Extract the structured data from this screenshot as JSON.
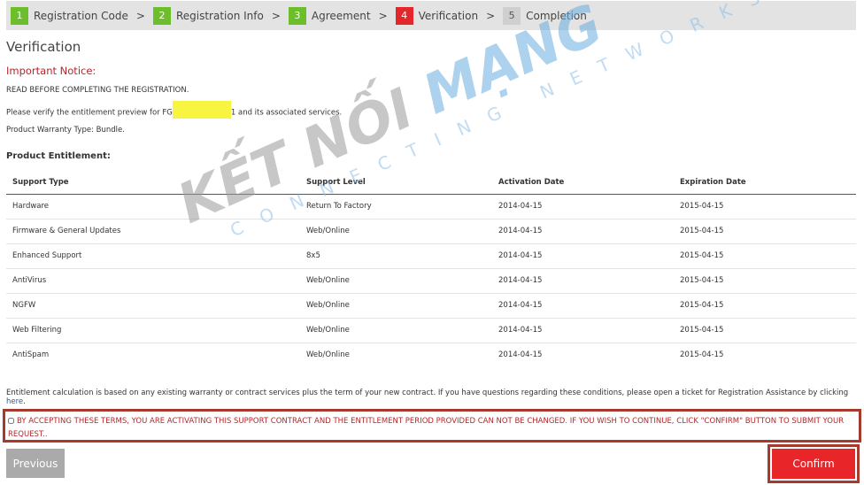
{
  "steps": [
    {
      "num": "1",
      "label": "Registration Code",
      "state": "done"
    },
    {
      "num": "2",
      "label": "Registration Info",
      "state": "done"
    },
    {
      "num": "3",
      "label": "Agreement",
      "state": "done"
    },
    {
      "num": "4",
      "label": "Verification",
      "state": "current"
    },
    {
      "num": "5",
      "label": "Completion",
      "state": "pending"
    }
  ],
  "step_separator": ">",
  "title": "Verification",
  "notice_title": "Important Notice:",
  "notice_line1": "READ BEFORE COMPLETING THE REGISTRATION.",
  "verify_prefix": "Please verify the entitlement preview for FG",
  "verify_suffix": "1 and its associated services.",
  "warranty": "Product Warranty Type:  Bundle.",
  "entitlement_title": "Product Entitlement:",
  "table": {
    "headers": [
      "Support Type",
      "Support Level",
      "Activation Date",
      "Expiration Date"
    ],
    "rows": [
      [
        "Hardware",
        "Return To Factory",
        "2014-04-15",
        "2015-04-15"
      ],
      [
        "Firmware & General Updates",
        "Web/Online",
        "2014-04-15",
        "2015-04-15"
      ],
      [
        "Enhanced Support",
        "8x5",
        "2014-04-15",
        "2015-04-15"
      ],
      [
        "AntiVirus",
        "Web/Online",
        "2014-04-15",
        "2015-04-15"
      ],
      [
        "NGFW",
        "Web/Online",
        "2014-04-15",
        "2015-04-15"
      ],
      [
        "Web Filtering",
        "Web/Online",
        "2014-04-15",
        "2015-04-15"
      ],
      [
        "AntiSpam",
        "Web/Online",
        "2014-04-15",
        "2015-04-15"
      ]
    ]
  },
  "footnote": "Entitlement calculation is based on any existing warranty or contract services plus the term of your new contract. If you have questions regarding these conditions, please open a ticket for Registration Assistance by clicking ",
  "footnote_link": "here",
  "footnote_end": ".",
  "terms": "BY ACCEPTING THESE TERMS, YOU ARE ACTIVATING THIS SUPPORT CONTRACT AND THE ENTITLEMENT PERIOD PROVIDED CAN NOT BE CHANGED. IF YOU WISH TO CONTINUE, CLICK \"CONFIRM\" BUTTON TO SUBMIT YOUR REQUEST..",
  "terms_checked": false,
  "buttons": {
    "previous": "Previous",
    "confirm": "Confirm"
  },
  "watermark": {
    "line1a": "KẾT NỐI ",
    "line1b": "MẠNG",
    "line2": "CONNECTING NETWORKS"
  },
  "colors": {
    "done": "#6cbf2a",
    "current": "#e3262a",
    "pending": "#cfcfcf",
    "accent": "#e8262a",
    "notice": "#b3262a"
  }
}
